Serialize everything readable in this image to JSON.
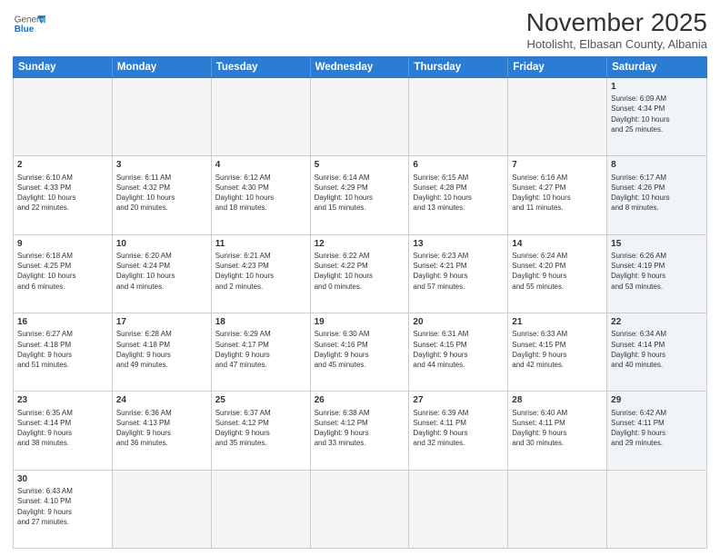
{
  "header": {
    "logo_general": "General",
    "logo_blue": "Blue",
    "month_title": "November 2025",
    "subtitle": "Hotolisht, Elbasan County, Albania"
  },
  "weekdays": [
    "Sunday",
    "Monday",
    "Tuesday",
    "Wednesday",
    "Thursday",
    "Friday",
    "Saturday"
  ],
  "weeks": [
    [
      {
        "day": "",
        "info": "",
        "empty": true
      },
      {
        "day": "",
        "info": "",
        "empty": true
      },
      {
        "day": "",
        "info": "",
        "empty": true
      },
      {
        "day": "",
        "info": "",
        "empty": true
      },
      {
        "day": "",
        "info": "",
        "empty": true
      },
      {
        "day": "",
        "info": "",
        "empty": true
      },
      {
        "day": "1",
        "info": "Sunrise: 6:09 AM\nSunset: 4:34 PM\nDaylight: 10 hours\nand 25 minutes."
      }
    ],
    [
      {
        "day": "2",
        "info": "Sunrise: 6:10 AM\nSunset: 4:33 PM\nDaylight: 10 hours\nand 22 minutes."
      },
      {
        "day": "3",
        "info": "Sunrise: 6:11 AM\nSunset: 4:32 PM\nDaylight: 10 hours\nand 20 minutes."
      },
      {
        "day": "4",
        "info": "Sunrise: 6:12 AM\nSunset: 4:30 PM\nDaylight: 10 hours\nand 18 minutes."
      },
      {
        "day": "5",
        "info": "Sunrise: 6:14 AM\nSunset: 4:29 PM\nDaylight: 10 hours\nand 15 minutes."
      },
      {
        "day": "6",
        "info": "Sunrise: 6:15 AM\nSunset: 4:28 PM\nDaylight: 10 hours\nand 13 minutes."
      },
      {
        "day": "7",
        "info": "Sunrise: 6:16 AM\nSunset: 4:27 PM\nDaylight: 10 hours\nand 11 minutes."
      },
      {
        "day": "8",
        "info": "Sunrise: 6:17 AM\nSunset: 4:26 PM\nDaylight: 10 hours\nand 8 minutes."
      }
    ],
    [
      {
        "day": "9",
        "info": "Sunrise: 6:18 AM\nSunset: 4:25 PM\nDaylight: 10 hours\nand 6 minutes."
      },
      {
        "day": "10",
        "info": "Sunrise: 6:20 AM\nSunset: 4:24 PM\nDaylight: 10 hours\nand 4 minutes."
      },
      {
        "day": "11",
        "info": "Sunrise: 6:21 AM\nSunset: 4:23 PM\nDaylight: 10 hours\nand 2 minutes."
      },
      {
        "day": "12",
        "info": "Sunrise: 6:22 AM\nSunset: 4:22 PM\nDaylight: 10 hours\nand 0 minutes."
      },
      {
        "day": "13",
        "info": "Sunrise: 6:23 AM\nSunset: 4:21 PM\nDaylight: 9 hours\nand 57 minutes."
      },
      {
        "day": "14",
        "info": "Sunrise: 6:24 AM\nSunset: 4:20 PM\nDaylight: 9 hours\nand 55 minutes."
      },
      {
        "day": "15",
        "info": "Sunrise: 6:26 AM\nSunset: 4:19 PM\nDaylight: 9 hours\nand 53 minutes."
      }
    ],
    [
      {
        "day": "16",
        "info": "Sunrise: 6:27 AM\nSunset: 4:18 PM\nDaylight: 9 hours\nand 51 minutes."
      },
      {
        "day": "17",
        "info": "Sunrise: 6:28 AM\nSunset: 4:18 PM\nDaylight: 9 hours\nand 49 minutes."
      },
      {
        "day": "18",
        "info": "Sunrise: 6:29 AM\nSunset: 4:17 PM\nDaylight: 9 hours\nand 47 minutes."
      },
      {
        "day": "19",
        "info": "Sunrise: 6:30 AM\nSunset: 4:16 PM\nDaylight: 9 hours\nand 45 minutes."
      },
      {
        "day": "20",
        "info": "Sunrise: 6:31 AM\nSunset: 4:15 PM\nDaylight: 9 hours\nand 44 minutes."
      },
      {
        "day": "21",
        "info": "Sunrise: 6:33 AM\nSunset: 4:15 PM\nDaylight: 9 hours\nand 42 minutes."
      },
      {
        "day": "22",
        "info": "Sunrise: 6:34 AM\nSunset: 4:14 PM\nDaylight: 9 hours\nand 40 minutes."
      }
    ],
    [
      {
        "day": "23",
        "info": "Sunrise: 6:35 AM\nSunset: 4:14 PM\nDaylight: 9 hours\nand 38 minutes."
      },
      {
        "day": "24",
        "info": "Sunrise: 6:36 AM\nSunset: 4:13 PM\nDaylight: 9 hours\nand 36 minutes."
      },
      {
        "day": "25",
        "info": "Sunrise: 6:37 AM\nSunset: 4:12 PM\nDaylight: 9 hours\nand 35 minutes."
      },
      {
        "day": "26",
        "info": "Sunrise: 6:38 AM\nSunset: 4:12 PM\nDaylight: 9 hours\nand 33 minutes."
      },
      {
        "day": "27",
        "info": "Sunrise: 6:39 AM\nSunset: 4:11 PM\nDaylight: 9 hours\nand 32 minutes."
      },
      {
        "day": "28",
        "info": "Sunrise: 6:40 AM\nSunset: 4:11 PM\nDaylight: 9 hours\nand 30 minutes."
      },
      {
        "day": "29",
        "info": "Sunrise: 6:42 AM\nSunset: 4:11 PM\nDaylight: 9 hours\nand 29 minutes."
      }
    ],
    [
      {
        "day": "30",
        "info": "Sunrise: 6:43 AM\nSunset: 4:10 PM\nDaylight: 9 hours\nand 27 minutes."
      },
      {
        "day": "",
        "info": "",
        "empty": true
      },
      {
        "day": "",
        "info": "",
        "empty": true
      },
      {
        "day": "",
        "info": "",
        "empty": true
      },
      {
        "day": "",
        "info": "",
        "empty": true
      },
      {
        "day": "",
        "info": "",
        "empty": true
      },
      {
        "day": "",
        "info": "",
        "empty": true
      }
    ]
  ]
}
